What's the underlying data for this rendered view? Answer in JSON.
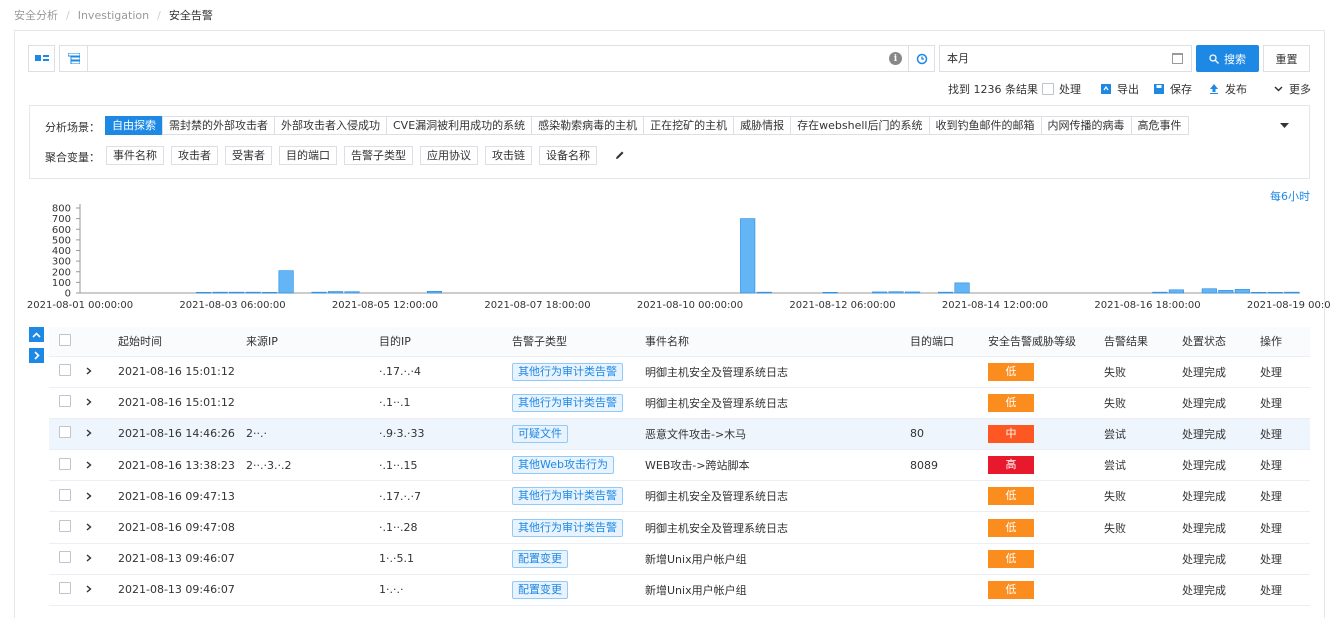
{
  "breadcrumb": [
    "安全分析",
    "Investigation",
    "安全告警"
  ],
  "search": {
    "date_value": "本月",
    "search_label": "搜索",
    "reset_label": "重置"
  },
  "toolbar": {
    "found": "找到 1236 条结果",
    "process": "处理",
    "export": "导出",
    "save": "保存",
    "publish": "发布",
    "more": "更多"
  },
  "scenes": {
    "label": "分析场景：",
    "items": [
      "自由探索",
      "需封禁的外部攻击者",
      "外部攻击者入侵成功",
      "CVE漏洞被利用成功的系统",
      "感染勒索病毒的主机",
      "正在挖矿的主机",
      "威胁情报",
      "存在webshell后门的系统",
      "收到钓鱼邮件的邮箱",
      "内网传播的病毒",
      "高危事件"
    ],
    "active": 0
  },
  "aggregate": {
    "label": "聚合变量：",
    "items": [
      "事件名称",
      "攻击者",
      "受害者",
      "目的端口",
      "告警子类型",
      "应用协议",
      "攻击链",
      "设备名称"
    ]
  },
  "interval": "每6小时",
  "chart_data": {
    "type": "bar",
    "ylim": [
      0,
      800
    ],
    "yticks": [
      0,
      100,
      200,
      300,
      400,
      500,
      600,
      700,
      800
    ],
    "xtick_labels": [
      "2021-08-01 00:00:00",
      "2021-08-03 06:00:00",
      "2021-08-05 12:00:00",
      "2021-08-07 18:00:00",
      "2021-08-10 00:00:00",
      "2021-08-12 06:00:00",
      "2021-08-14 12:00:00",
      "2021-08-16 18:00:00",
      "2021-08-19 00:00:00"
    ],
    "bin_hours": 6,
    "bins": 74,
    "bars": [
      {
        "i": 7,
        "v": 6
      },
      {
        "i": 8,
        "v": 8
      },
      {
        "i": 9,
        "v": 8
      },
      {
        "i": 10,
        "v": 8
      },
      {
        "i": 11,
        "v": 6
      },
      {
        "i": 12,
        "v": 210
      },
      {
        "i": 14,
        "v": 8
      },
      {
        "i": 15,
        "v": 14
      },
      {
        "i": 16,
        "v": 12
      },
      {
        "i": 21,
        "v": 16
      },
      {
        "i": 40,
        "v": 700
      },
      {
        "i": 41,
        "v": 8
      },
      {
        "i": 45,
        "v": 6
      },
      {
        "i": 48,
        "v": 10
      },
      {
        "i": 49,
        "v": 12
      },
      {
        "i": 50,
        "v": 10
      },
      {
        "i": 52,
        "v": 8
      },
      {
        "i": 53,
        "v": 95
      },
      {
        "i": 65,
        "v": 8
      },
      {
        "i": 66,
        "v": 30
      },
      {
        "i": 68,
        "v": 40
      },
      {
        "i": 69,
        "v": 25
      },
      {
        "i": 70,
        "v": 34
      },
      {
        "i": 71,
        "v": 6
      },
      {
        "i": 72,
        "v": 6
      },
      {
        "i": 73,
        "v": 8
      }
    ]
  },
  "table": {
    "columns": [
      "起始时间",
      "来源IP",
      "目的IP",
      "告警子类型",
      "事件名称",
      "目的端口",
      "安全告警威胁等级",
      "告警结果",
      "处置状态",
      "操作"
    ],
    "rows": [
      {
        "time": "2021-08-16 15:01:12",
        "src": "",
        "dst": "·.17.·.·4",
        "type": "其他行为审计类告警",
        "event": "明御主机安全及管理系统日志",
        "port": "",
        "level": "低",
        "result": "失败",
        "status": "处理完成",
        "op": "处理"
      },
      {
        "time": "2021-08-16 15:01:12",
        "src": "",
        "dst": "·.1··.1",
        "type": "其他行为审计类告警",
        "event": "明御主机安全及管理系统日志",
        "port": "",
        "level": "低",
        "result": "失败",
        "status": "处理完成",
        "op": "处理"
      },
      {
        "time": "2021-08-16 14:46:26",
        "src": "2··.·",
        "dst": "·.9·3.·33",
        "type": "可疑文件",
        "event": "恶意文件攻击->木马",
        "port": "80",
        "level": "中",
        "result": "尝试",
        "status": "处理完成",
        "op": "处理"
      },
      {
        "time": "2021-08-16 13:38:23",
        "src": "2··.·3.·.2",
        "dst": "·.1··.15",
        "type": "其他Web攻击行为",
        "event": "WEB攻击->跨站脚本",
        "port": "8089",
        "level": "高",
        "result": "尝试",
        "status": "处理完成",
        "op": "处理"
      },
      {
        "time": "2021-08-16 09:47:13",
        "src": "",
        "dst": "·.17.·.·7",
        "type": "其他行为审计类告警",
        "event": "明御主机安全及管理系统日志",
        "port": "",
        "level": "低",
        "result": "失败",
        "status": "处理完成",
        "op": "处理"
      },
      {
        "time": "2021-08-16 09:47:08",
        "src": "",
        "dst": "·.1··.28",
        "type": "其他行为审计类告警",
        "event": "明御主机安全及管理系统日志",
        "port": "",
        "level": "低",
        "result": "失败",
        "status": "处理完成",
        "op": "处理"
      },
      {
        "time": "2021-08-13 09:46:07",
        "src": "",
        "dst": "1·.·5.1",
        "type": "配置变更",
        "event": "新增Unix用户帐户组",
        "port": "",
        "level": "低",
        "result": "",
        "status": "处理完成",
        "op": "处理"
      },
      {
        "time": "2021-08-13 09:46:07",
        "src": "",
        "dst": "1·.·.·",
        "type": "配置变更",
        "event": "新增Unix用户帐户组",
        "port": "",
        "level": "低",
        "result": "",
        "status": "处理完成",
        "op": "处理"
      }
    ]
  },
  "colors": {
    "accent": "#1e88e5",
    "low": "#fb8c1e",
    "mid": "#ff5722",
    "high": "#e8192c",
    "done": "#52c41a",
    "bar": "#64b5f6"
  }
}
